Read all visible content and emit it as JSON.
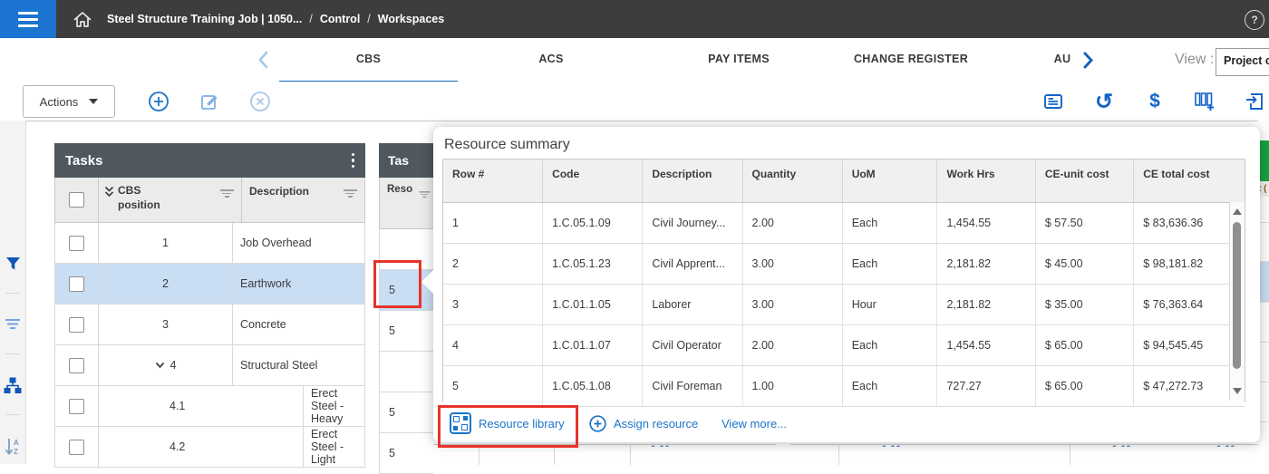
{
  "topbar": {
    "breadcrumb": [
      "Steel Structure Training Job | 1050...",
      "Control",
      "Workspaces"
    ]
  },
  "icons": {
    "help": "?",
    "undo": "↺",
    "currency": "$"
  },
  "tabs": {
    "items": [
      {
        "label": "CBS",
        "active": true
      },
      {
        "label": "ACS",
        "active": false
      },
      {
        "label": "PAY ITEMS",
        "active": false
      },
      {
        "label": "CHANGE REGISTER",
        "active": false
      },
      {
        "label": "AU",
        "active": false
      }
    ],
    "view_label": "View :",
    "view_value": "Project c"
  },
  "toolbar": {
    "actions_label": "Actions"
  },
  "tasks": {
    "title": "Tasks",
    "columns": [
      "CBS position",
      "Description"
    ],
    "rows": [
      {
        "cbs": "1",
        "description": "Job Overhead"
      },
      {
        "cbs": "2",
        "description": "Earthwork"
      },
      {
        "cbs": "3",
        "description": "Concrete"
      },
      {
        "cbs": "4",
        "description": "Structural Steel"
      },
      {
        "cbs": "4.1",
        "description": "Erect Steel - Heavy"
      },
      {
        "cbs": "4.2",
        "description": "Erect Steel - Light"
      }
    ]
  },
  "mini_panel": {
    "title": "Tas",
    "column": "Reso",
    "values": [
      "",
      "5",
      "5",
      "",
      "5",
      "5"
    ]
  },
  "popup": {
    "title": "Resource summary",
    "columns": [
      "Row #",
      "Code",
      "Description",
      "Quantity",
      "UoM",
      "Work Hrs",
      "CE-unit cost",
      "CE total cost"
    ],
    "rows": [
      {
        "row": "1",
        "code": "1.C.05.1.09",
        "description": "Civil Journey...",
        "quantity": "2.00",
        "uom": "Each",
        "work_hrs": "1,454.55",
        "ce_unit": "$ 57.50",
        "ce_total": "$ 83,636.36"
      },
      {
        "row": "2",
        "code": "1.C.05.1.23",
        "description": "Civil Apprent...",
        "quantity": "3.00",
        "uom": "Each",
        "work_hrs": "2,181.82",
        "ce_unit": "$ 45.00",
        "ce_total": "$ 98,181.82"
      },
      {
        "row": "3",
        "code": "1.C.01.1.05",
        "description": "Laborer",
        "quantity": "3.00",
        "uom": "Hour",
        "work_hrs": "2,181.82",
        "ce_unit": "$ 35.00",
        "ce_total": "$ 76,363.64"
      },
      {
        "row": "4",
        "code": "1.C.01.1.07",
        "description": "Civil Operator",
        "quantity": "2.00",
        "uom": "Each",
        "work_hrs": "1,454.55",
        "ce_unit": "$ 65.00",
        "ce_total": "$ 94,545.45"
      },
      {
        "row": "5",
        "code": "1.C.05.1.08",
        "description": "Civil Foreman",
        "quantity": "1.00",
        "uom": "Each",
        "work_hrs": "727.27",
        "ce_unit": "$ 65.00",
        "ce_total": "$ 47,272.73"
      }
    ],
    "footer": {
      "resource_library": "Resource library",
      "assign_resource": "Assign resource",
      "view_more": "View more..."
    }
  },
  "right_strip": {
    "header_fragment": "t ("
  },
  "colors": {
    "accent_blue": "#1b74c9",
    "selection_blue": "#c9ddf3",
    "annotation_red": "#e8332b",
    "panel_header_slate": "#4e585e",
    "topbar_gray": "#3d3d3d",
    "hamburger_blue": "#1b74cf",
    "green_header": "#17a33e"
  }
}
